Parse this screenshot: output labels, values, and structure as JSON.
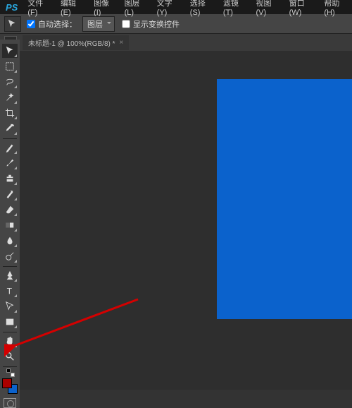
{
  "app": {
    "logo": "PS"
  },
  "menu": [
    "文件(F)",
    "编辑(E)",
    "图像(I)",
    "图层(L)",
    "文字(Y)",
    "选择(S)",
    "滤镜(T)",
    "视图(V)",
    "窗口(W)",
    "帮助(H)"
  ],
  "options": {
    "auto_select_label": "自动选择：",
    "target": "图层",
    "show_transform_label": "显示变换控件"
  },
  "tab": {
    "title": "未标题-1 @ 100%(RGB/8) *"
  },
  "colors": {
    "canvas": "#0b62cc",
    "fg": "#a00",
    "bg": "#0b62cc",
    "arrow": "#d40000"
  },
  "tools": [
    "move",
    "marquee",
    "lasso",
    "wand",
    "crop",
    "eyedropper",
    "heal",
    "brush",
    "stamp",
    "history",
    "eraser",
    "gradient",
    "blur",
    "dodge",
    "pen",
    "type",
    "path",
    "shape",
    "hand",
    "zoom"
  ]
}
